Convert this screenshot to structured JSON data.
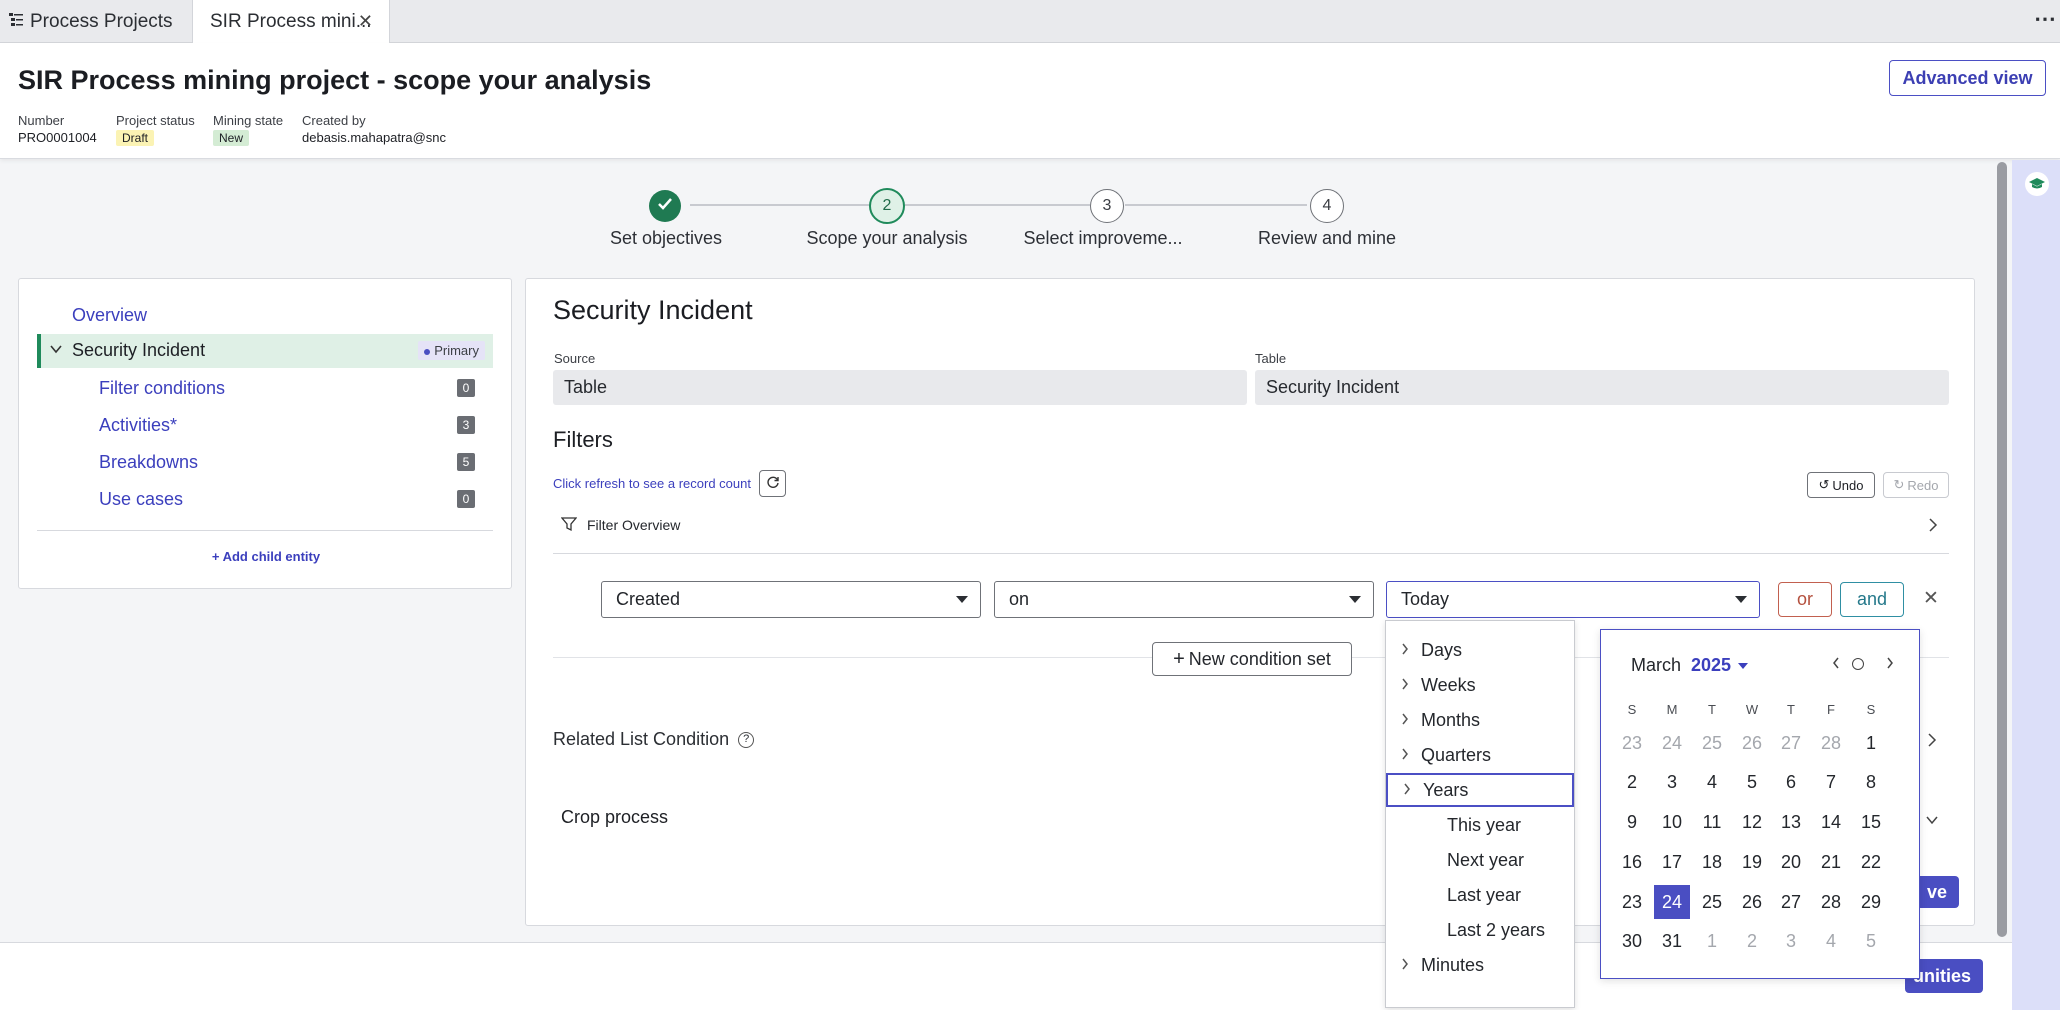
{
  "tabs": [
    {
      "label": "Process Projects"
    },
    {
      "label": "SIR Process mini..."
    }
  ],
  "header": {
    "title": "SIR Process mining project - scope your analysis",
    "advanced_view": "Advanced view",
    "meta": {
      "number_label": "Number",
      "number_value": "PRO0001004",
      "status_label": "Project status",
      "status_value": "Draft",
      "mining_label": "Mining state",
      "mining_value": "New",
      "created_label": "Created by",
      "created_value": "debasis.mahapatra@snc"
    }
  },
  "stepper": {
    "steps": [
      {
        "num": "",
        "label": "Set objectives"
      },
      {
        "num": "2",
        "label": "Scope your analysis"
      },
      {
        "num": "3",
        "label": "Select improveme..."
      },
      {
        "num": "4",
        "label": "Review and mine"
      }
    ]
  },
  "sidebar": {
    "overview": "Overview",
    "entity": "Security Incident",
    "primary_badge": "Primary",
    "items": [
      {
        "label": "Filter conditions",
        "count": "0"
      },
      {
        "label": "Activities*",
        "count": "3"
      },
      {
        "label": "Breakdowns",
        "count": "5"
      },
      {
        "label": "Use cases",
        "count": "0"
      }
    ],
    "add_child": "+ Add child entity"
  },
  "main": {
    "title": "Security Incident",
    "source_label": "Source",
    "source_value": "Table",
    "table_label": "Table",
    "table_value": "Security Incident",
    "filters_heading": "Filters",
    "refresh_hint": "Click refresh to see a record count",
    "undo": "Undo",
    "redo": "Redo",
    "filter_overview": "Filter Overview",
    "condition": {
      "field": "Created",
      "operator": "on",
      "value": "Today"
    },
    "or_label": "or",
    "and_label": "and",
    "new_condition_set": "New condition set",
    "related_list": "Related List Condition",
    "crop_process": "Crop process",
    "save_partial": "ve",
    "opportunities_partial": "unities"
  },
  "dropdown": {
    "items": [
      {
        "label": "Days",
        "expandable": true
      },
      {
        "label": "Weeks",
        "expandable": true
      },
      {
        "label": "Months",
        "expandable": true
      },
      {
        "label": "Quarters",
        "expandable": true
      },
      {
        "label": "Years",
        "expandable": true,
        "focused": true
      },
      {
        "label": "This year",
        "expandable": false
      },
      {
        "label": "Next year",
        "expandable": false
      },
      {
        "label": "Last year",
        "expandable": false
      },
      {
        "label": "Last 2 years",
        "expandable": false
      },
      {
        "label": "Minutes",
        "expandable": true
      }
    ]
  },
  "calendar": {
    "month": "March",
    "year": "2025",
    "dow": [
      "S",
      "M",
      "T",
      "W",
      "T",
      "F",
      "S"
    ],
    "weeks": [
      [
        "23",
        "24",
        "25",
        "26",
        "27",
        "28",
        "1"
      ],
      [
        "2",
        "3",
        "4",
        "5",
        "6",
        "7",
        "8"
      ],
      [
        "9",
        "10",
        "11",
        "12",
        "13",
        "14",
        "15"
      ],
      [
        "16",
        "17",
        "18",
        "19",
        "20",
        "21",
        "22"
      ],
      [
        "23",
        "24",
        "25",
        "26",
        "27",
        "28",
        "29"
      ],
      [
        "30",
        "31",
        "1",
        "2",
        "3",
        "4",
        "5"
      ]
    ],
    "muted": [
      [
        0,
        0
      ],
      [
        0,
        1
      ],
      [
        0,
        2
      ],
      [
        0,
        3
      ],
      [
        0,
        4
      ],
      [
        0,
        5
      ],
      [
        5,
        2
      ],
      [
        5,
        3
      ],
      [
        5,
        4
      ],
      [
        5,
        5
      ],
      [
        5,
        6
      ]
    ],
    "selected": [
      4,
      1
    ]
  },
  "colors": {
    "accent": "#4a4ec2",
    "success": "#1f8a5b",
    "draft_bg": "#fbf3b4",
    "new_bg": "#d4ecd4"
  }
}
